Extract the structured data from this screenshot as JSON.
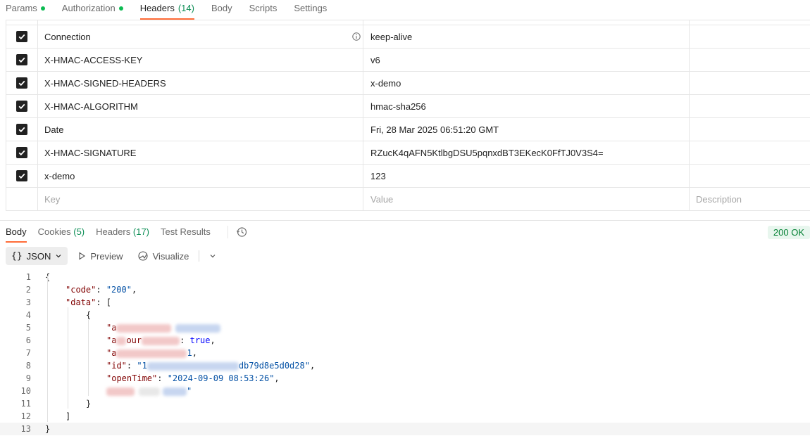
{
  "request_tabs": [
    {
      "label": "Params",
      "dot": true
    },
    {
      "label": "Authorization",
      "dot": true
    },
    {
      "label": "Headers",
      "count": "(14)",
      "active": true
    },
    {
      "label": "Body"
    },
    {
      "label": "Scripts"
    },
    {
      "label": "Settings"
    }
  ],
  "headers": [
    {
      "key": "Connection",
      "value": "keep-alive",
      "checked": true,
      "info": true
    },
    {
      "key": "X-HMAC-ACCESS-KEY",
      "value": "v6",
      "checked": true
    },
    {
      "key": "X-HMAC-SIGNED-HEADERS",
      "value": "x-demo",
      "checked": true
    },
    {
      "key": "X-HMAC-ALGORITHM",
      "value": "hmac-sha256",
      "checked": true
    },
    {
      "key": "Date",
      "value": "Fri, 28 Mar 2025 06:51:20 GMT",
      "checked": true
    },
    {
      "key": "X-HMAC-SIGNATURE",
      "value": "RZucK4qAFN5KtlbgDSU5pqnxdBT3EKecK0FfTJ0V3S4=",
      "checked": true
    },
    {
      "key": "x-demo",
      "value": "123",
      "checked": true
    }
  ],
  "new_row": {
    "key_placeholder": "Key",
    "value_placeholder": "Value",
    "desc_placeholder": "Description"
  },
  "response_tabs": [
    {
      "label": "Body",
      "active": true
    },
    {
      "label": "Cookies",
      "count": "(5)"
    },
    {
      "label": "Headers",
      "count": "(17)"
    },
    {
      "label": "Test Results"
    }
  ],
  "status": "200 OK",
  "toolbar": {
    "format": "JSON",
    "preview": "Preview",
    "visualize": "Visualize"
  },
  "code_lines": [
    {
      "n": "1"
    },
    {
      "n": "2"
    },
    {
      "n": "3"
    },
    {
      "n": "4"
    },
    {
      "n": "5"
    },
    {
      "n": "6"
    },
    {
      "n": "7"
    },
    {
      "n": "8"
    },
    {
      "n": "9"
    },
    {
      "n": "10"
    },
    {
      "n": "11"
    },
    {
      "n": "12"
    },
    {
      "n": "13"
    }
  ],
  "code_text": {
    "l1": "{",
    "l2_key": "\"code\"",
    "l2_val": "\"200\"",
    "l3_key": "\"data\"",
    "l3_rest": ": [",
    "l4": "{",
    "l5_key": "\"a",
    "l6_key": "\"a",
    "l6_mid": "our",
    "l6_val": "true",
    "l7_key": "\"a",
    "l7_val": "1",
    "l8_key": "\"id\"",
    "l8_val_start": "\"1",
    "l8_val_end": "db79d8e5d0d28\"",
    "l9_key": "\"openTime\"",
    "l9_val": "\"2024-09-09 08:53:26\"",
    "l10_end": "\"",
    "l11": "}",
    "l12": "]",
    "l13": "}"
  },
  "colors": {
    "accent": "#ff6c37",
    "status_green": "#007f31",
    "dot_green": "#0cbb52"
  },
  "icons": [
    "info-icon",
    "history-icon",
    "play-icon",
    "visualize-icon",
    "chevron-down-icon",
    "checkmark-icon"
  ]
}
